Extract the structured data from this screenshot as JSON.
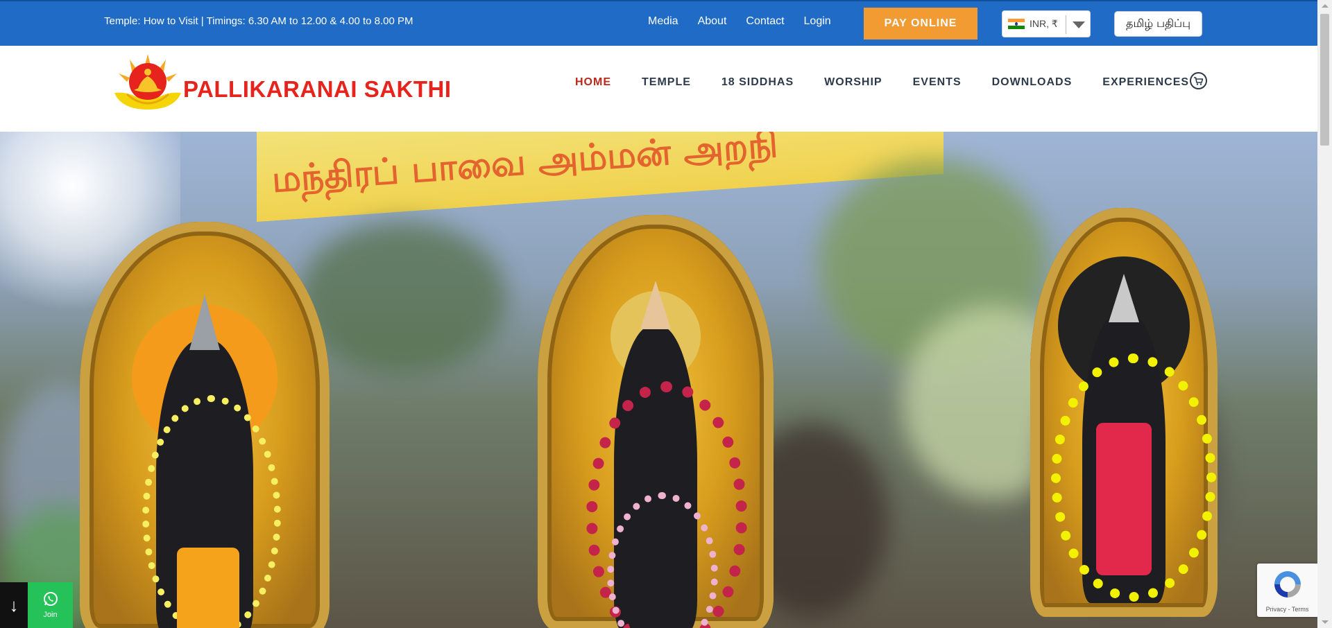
{
  "topbar": {
    "info_text": "Temple: How to Visit | Timings: 6.30 AM to 12.00 & 4.00 to 8.00 PM",
    "links": [
      "Media",
      "About",
      "Contact",
      "Login"
    ],
    "pay_button": "PAY ONLINE",
    "currency": {
      "code": "INR, ₹",
      "flag": "india-flag-icon"
    },
    "tamil_button": "தமிழ் பதிப்பு",
    "bar_color": "#1f6bc6",
    "pay_color": "#f29b33"
  },
  "header": {
    "brand": "PALLIKARANAI SAKTHI",
    "nav": [
      "HOME",
      "TEMPLE",
      "18 SIDDHAS",
      "WORSHIP",
      "EVENTS",
      "DOWNLOADS",
      "EXPERIENCES"
    ],
    "active_nav": "HOME",
    "cart_icon": "cart-icon"
  },
  "hero": {
    "banner_text": "மந்திரப் பாவை அம்மன் அறநி"
  },
  "widgets": {
    "scroll_arrow": "↓",
    "whatsapp_label": "Join",
    "recaptcha_terms": "Privacy - Terms"
  }
}
